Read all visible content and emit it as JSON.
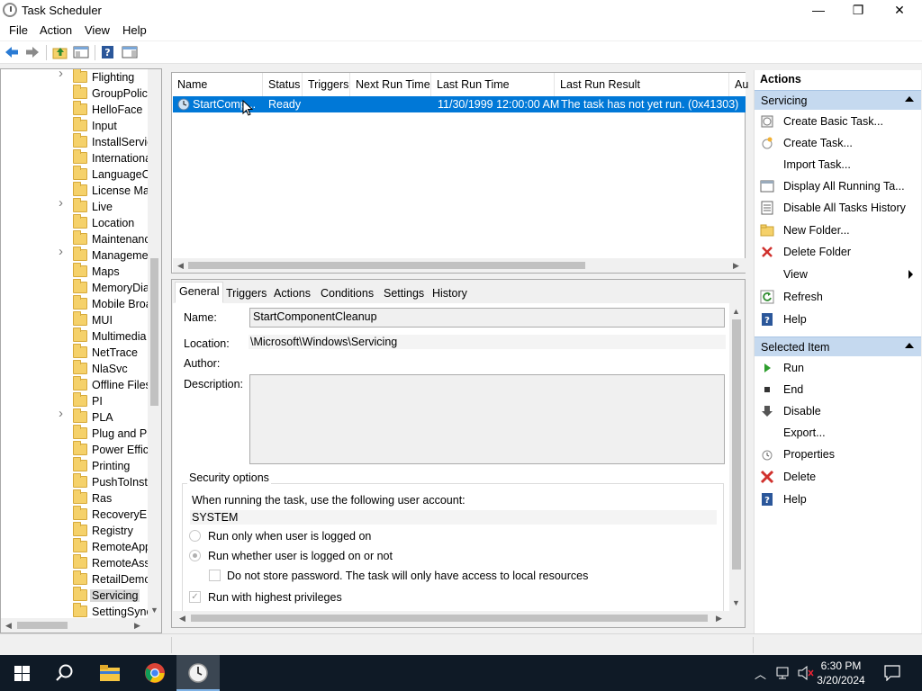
{
  "window": {
    "title": "Task Scheduler",
    "minimize": "—",
    "maximize": "❐",
    "close": "✕"
  },
  "menu": [
    "File",
    "Action",
    "View",
    "Help"
  ],
  "tree": {
    "items": [
      {
        "label": "Flighting",
        "expandable": true
      },
      {
        "label": "GroupPolicy",
        "expandable": false
      },
      {
        "label": "HelloFace",
        "expandable": false
      },
      {
        "label": "Input",
        "expandable": false
      },
      {
        "label": "InstallService",
        "expandable": false
      },
      {
        "label": "International",
        "expandable": false
      },
      {
        "label": "LanguageComponentsInstaller",
        "expandable": false
      },
      {
        "label": "License Manager",
        "expandable": false
      },
      {
        "label": "Live",
        "expandable": true
      },
      {
        "label": "Location",
        "expandable": false
      },
      {
        "label": "Maintenance",
        "expandable": false
      },
      {
        "label": "Management",
        "expandable": true
      },
      {
        "label": "Maps",
        "expandable": false
      },
      {
        "label": "MemoryDiagnostic",
        "expandable": false
      },
      {
        "label": "Mobile Broadband Accounts",
        "expandable": false
      },
      {
        "label": "MUI",
        "expandable": false
      },
      {
        "label": "Multimedia",
        "expandable": false
      },
      {
        "label": "NetTrace",
        "expandable": false
      },
      {
        "label": "NlaSvc",
        "expandable": false
      },
      {
        "label": "Offline Files",
        "expandable": false
      },
      {
        "label": "PI",
        "expandable": false
      },
      {
        "label": "PLA",
        "expandable": true
      },
      {
        "label": "Plug and Play",
        "expandable": false
      },
      {
        "label": "Power Efficiency Diagnostics",
        "expandable": false
      },
      {
        "label": "Printing",
        "expandable": false
      },
      {
        "label": "PushToInstall",
        "expandable": false
      },
      {
        "label": "Ras",
        "expandable": false
      },
      {
        "label": "RecoveryEnvironment",
        "expandable": false
      },
      {
        "label": "Registry",
        "expandable": false
      },
      {
        "label": "RemoteApp and Desktop Connections Update",
        "expandable": false
      },
      {
        "label": "RemoteAssistance",
        "expandable": false
      },
      {
        "label": "RetailDemo",
        "expandable": false
      },
      {
        "label": "Servicing",
        "expandable": false,
        "selected": true
      },
      {
        "label": "SettingSync",
        "expandable": false
      }
    ]
  },
  "tasklist": {
    "columns": [
      "Name",
      "Status",
      "Triggers",
      "Next Run Time",
      "Last Run Time",
      "Last Run Result",
      "Au"
    ],
    "rows": [
      {
        "name": "StartComp...",
        "status": "Ready",
        "triggers": "",
        "next_run": "",
        "last_run": "11/30/1999 12:00:00 AM",
        "last_result": "The task has not yet run. (0x41303)"
      }
    ]
  },
  "details": {
    "tabs": [
      "General",
      "Triggers",
      "Actions",
      "Conditions",
      "Settings",
      "History"
    ],
    "active_tab": "General",
    "name_label": "Name:",
    "name_value": "StartComponentCleanup",
    "location_label": "Location:",
    "location_value": "\\Microsoft\\Windows\\Servicing",
    "author_label": "Author:",
    "author_value": "",
    "description_label": "Description:",
    "description_value": "",
    "security_title": "Security options",
    "account_prompt": "When running the task, use the following user account:",
    "account": "SYSTEM",
    "radio_logged_on": "Run only when user is logged on",
    "radio_whether": "Run whether user is logged on or not",
    "chk_no_store_password": "Do not store password.  The task will only have access to local resources",
    "chk_highest": "Run with highest privileges"
  },
  "actions": {
    "title": "Actions",
    "section1": "Servicing",
    "section1_items": [
      {
        "label": "Create Basic Task...",
        "icon": "create-basic-task-icon"
      },
      {
        "label": "Create Task...",
        "icon": "create-task-icon"
      },
      {
        "label": "Import Task...",
        "icon": ""
      },
      {
        "label": "Display All Running Ta...",
        "icon": "display-running-icon"
      },
      {
        "label": "Disable All Tasks History",
        "icon": "history-icon"
      },
      {
        "label": "New Folder...",
        "icon": "new-folder-icon"
      },
      {
        "label": "Delete Folder",
        "icon": "delete-folder-icon"
      },
      {
        "label": "View",
        "icon": "",
        "submenu": true
      },
      {
        "label": "Refresh",
        "icon": "refresh-icon"
      },
      {
        "label": "Help",
        "icon": "help-icon"
      }
    ],
    "section2": "Selected Item",
    "section2_items": [
      {
        "label": "Run",
        "icon": "run-icon"
      },
      {
        "label": "End",
        "icon": "end-icon"
      },
      {
        "label": "Disable",
        "icon": "disable-icon"
      },
      {
        "label": "Export...",
        "icon": ""
      },
      {
        "label": "Properties",
        "icon": "properties-icon"
      },
      {
        "label": "Delete",
        "icon": "delete-icon"
      },
      {
        "label": "Help",
        "icon": "help-icon"
      }
    ]
  },
  "taskbar": {
    "time": "6:30 PM",
    "date": "3/20/2024"
  },
  "colors": {
    "selection": "#0078d7",
    "section_header": "#c5d9ef",
    "taskbar": "#0f1a26"
  }
}
